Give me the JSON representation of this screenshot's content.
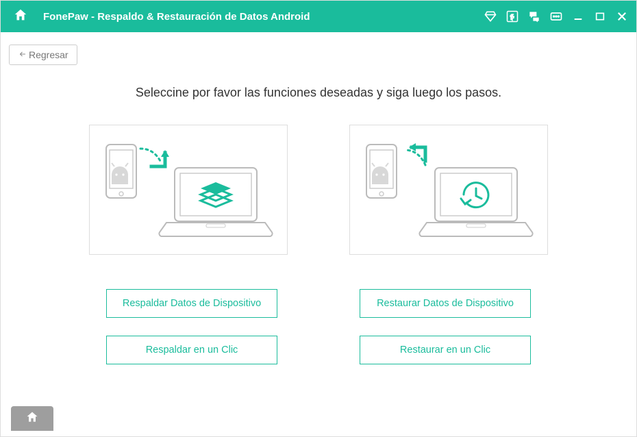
{
  "header": {
    "brand": "FonePaw",
    "title_suffix": " -  Respaldo & Restauración de Datos Android",
    "icons": {
      "home": "home-icon",
      "diamond": "diamond-icon",
      "facebook": "facebook-icon",
      "feedback": "feedback-icon",
      "more": "more-icon",
      "minimize": "minimize-icon",
      "maximize": "maximize-icon",
      "close": "close-icon"
    }
  },
  "back": {
    "label": "Regresar"
  },
  "main": {
    "headline": "Seleccine por favor las funciones deseadas y siga luego los pasos."
  },
  "actions": {
    "left": {
      "primary": "Respaldar Datos de Dispositivo",
      "secondary": "Respaldar en un Clic"
    },
    "right": {
      "primary": "Restaurar Datos de Dispositivo",
      "secondary": "Restaurar en un Clic"
    }
  },
  "colors": {
    "accent": "#1abc9c",
    "border": "#dddddd",
    "text": "#333333",
    "muted": "#888888"
  }
}
